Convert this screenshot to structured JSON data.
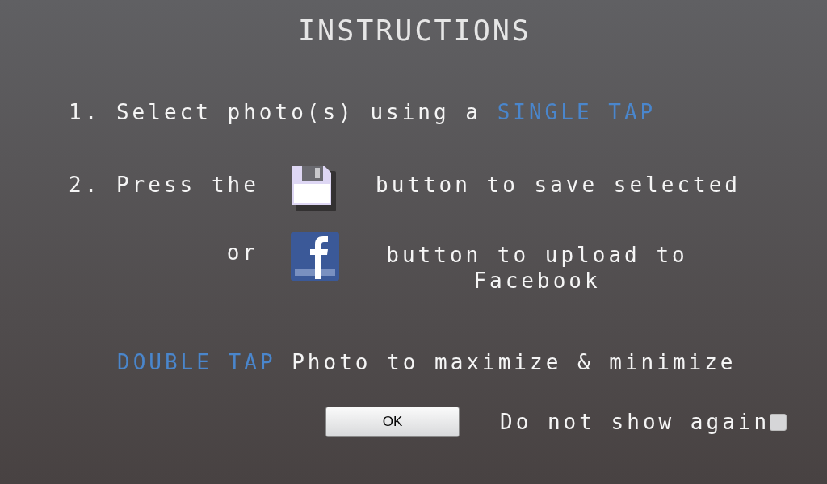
{
  "title": "INSTRUCTIONS",
  "step_1": {
    "segments": [
      {
        "text": "1. Select photo(s) using a",
        "kind": "plain"
      },
      {
        "text": "SINGLE TAP",
        "kind": "highlight"
      }
    ]
  },
  "step_2": [
    {
      "lead": "2. Press the",
      "kind": "save",
      "text": "button to save selected"
    },
    {
      "lead": "or",
      "kind": "facebook",
      "text": "button to upload to Facebook"
    }
  ],
  "tip": {
    "segments": [
      {
        "text": "DOUBLE TAP",
        "kind": "highlight"
      },
      {
        "text": "Photo to maximize & minimize",
        "kind": "plain"
      }
    ]
  },
  "ok_button": "OK",
  "dont_show": {
    "label": "Do not show again",
    "checked": false
  }
}
